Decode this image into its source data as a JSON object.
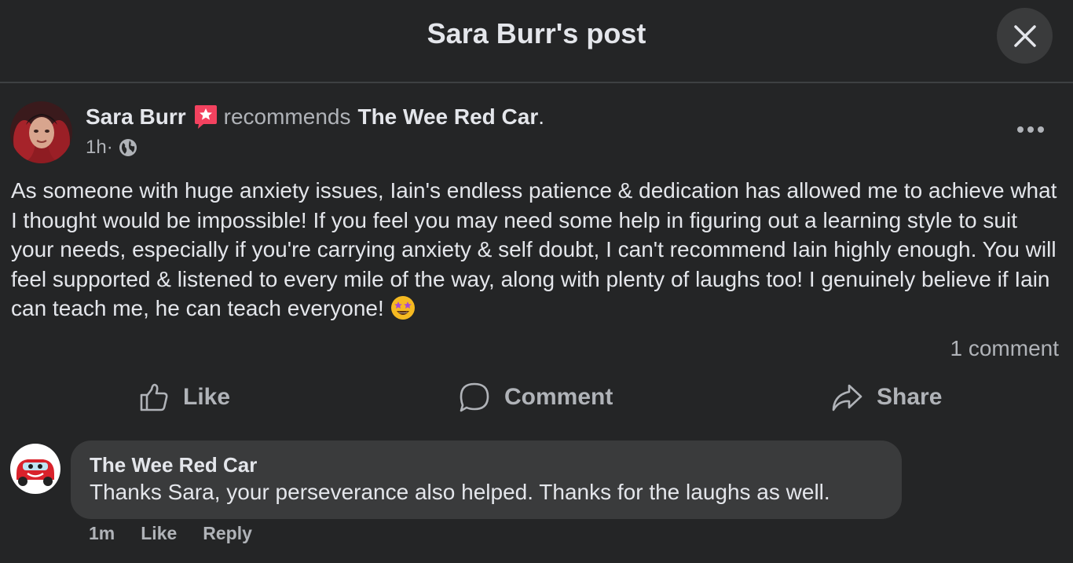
{
  "header": {
    "title": "Sara Burr's post",
    "close_icon": "close-icon"
  },
  "post": {
    "author": "Sara Burr",
    "badge_icon": "recommendation-star-icon",
    "verb": "recommends",
    "page": "The Wee Red Car",
    "period": ".",
    "time": "1h",
    "separator": " · ",
    "audience_icon": "globe-icon",
    "more_icon": "more-options-icon",
    "body": "As someone with huge anxiety issues, Iain's endless patience & dedication has allowed me to achieve what I thought would be impossible! If you feel you may need some help in figuring out a learning style to suit your needs, especially if you're carrying anxiety & self doubt, I can't recommend Iain highly enough. You will feel supported & listened to every mile of the way, along with plenty of laughs too! I genuinely believe if Iain can teach me, he can teach everyone!",
    "emoji": "star-struck-emoji",
    "comment_count": "1 comment"
  },
  "actions": {
    "like": "Like",
    "comment": "Comment",
    "share": "Share"
  },
  "comment": {
    "author": "The Wee Red Car",
    "text": "Thanks Sara, your perseverance also helped. Thanks for the laughs as well.",
    "time": "1m",
    "like": "Like",
    "reply": "Reply"
  },
  "colors": {
    "background": "#242526",
    "bubble": "#3a3b3c",
    "primary_text": "#e4e6eb",
    "secondary_text": "#b0b3b8",
    "badge": "#f3425f"
  }
}
